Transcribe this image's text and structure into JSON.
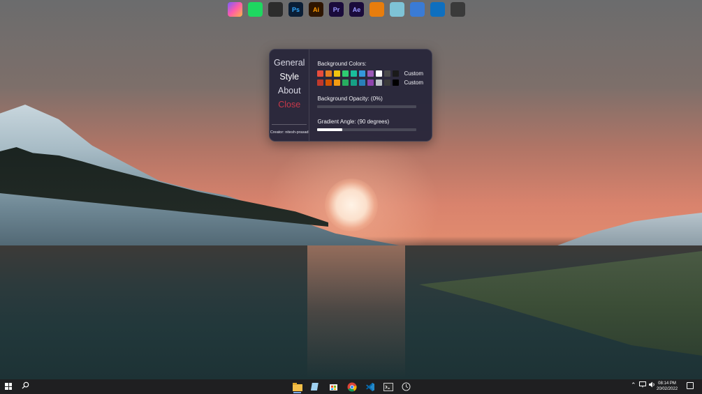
{
  "top_apps": [
    {
      "name": "nova",
      "label": "",
      "bg": "linear-gradient(135deg,#7a5cff,#ff5ca8,#ffb347)"
    },
    {
      "name": "spotify",
      "label": "",
      "bg": "#1ed760"
    },
    {
      "name": "figma",
      "label": "",
      "bg": "#2c2c2c"
    },
    {
      "name": "photoshop",
      "label": "Ps",
      "bg": "#0a1e36",
      "color": "#31a8ff"
    },
    {
      "name": "illustrator",
      "label": "Ai",
      "bg": "#2e1500",
      "color": "#ff9a00"
    },
    {
      "name": "premiere",
      "label": "Pr",
      "bg": "#1a0b3b",
      "color": "#9999ff"
    },
    {
      "name": "after-effects",
      "label": "Ae",
      "bg": "#1a0b3b",
      "color": "#9999ff"
    },
    {
      "name": "blender",
      "label": "",
      "bg": "#e87d0d"
    },
    {
      "name": "books",
      "label": "",
      "bg": "#7ec3d6"
    },
    {
      "name": "xd",
      "label": "",
      "bg": "#3a7bd5"
    },
    {
      "name": "vscode",
      "label": "",
      "bg": "#0e6fbf"
    },
    {
      "name": "settings",
      "label": "",
      "bg": "#3a3a3a"
    }
  ],
  "panel": {
    "nav": {
      "general": "General",
      "style": "Style",
      "about": "About",
      "close": "Close"
    },
    "creator": "Creator: nitesh-prasad",
    "background_colors_label": "Background Colors:",
    "color_rows": [
      {
        "swatches": [
          "#e74c3c",
          "#e67e22",
          "#f1c40f",
          "#2ecc71",
          "#1abc9c",
          "#3498db",
          "#9b59b6",
          "#ffffff",
          "#4a4a4a",
          "#1a1a1a"
        ],
        "custom": "Custom"
      },
      {
        "swatches": [
          "#c0392b",
          "#d35400",
          "#f39c12",
          "#27ae60",
          "#16a085",
          "#2980b9",
          "#8e44ad",
          "#bdc3c7",
          "#3a3a3a",
          "#000000"
        ],
        "custom": "Custom"
      }
    ],
    "opacity_label": "Background Opacity: (0%)",
    "opacity_value": 0,
    "gradient_label": "Gradient Angle: (90 degrees)",
    "gradient_value": 25
  },
  "taskbar": {
    "apps": [
      "file-explorer",
      "notepad",
      "store",
      "chrome",
      "vscode",
      "terminal",
      "extra-app"
    ],
    "time": "08:14 PM",
    "date": "20/02/2022"
  }
}
